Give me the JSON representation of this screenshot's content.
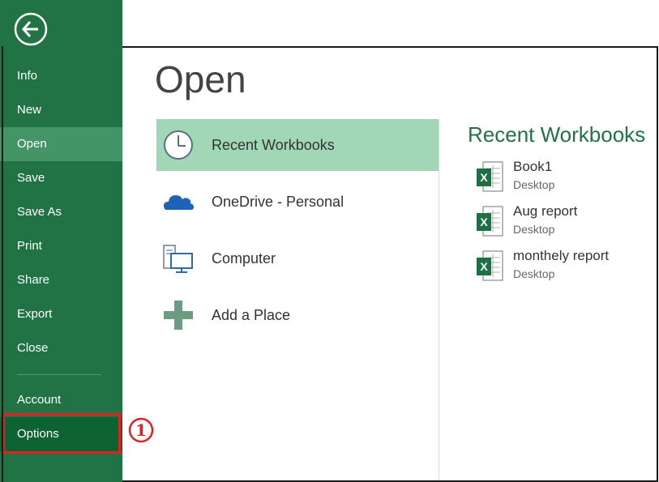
{
  "sidebar": {
    "back_icon": "back-arrow-icon",
    "items": [
      {
        "label": "Info"
      },
      {
        "label": "New"
      },
      {
        "label": "Open"
      },
      {
        "label": "Save"
      },
      {
        "label": "Save As"
      },
      {
        "label": "Print"
      },
      {
        "label": "Share"
      },
      {
        "label": "Export"
      },
      {
        "label": "Close"
      }
    ],
    "account_label": "Account",
    "options_label": "Options",
    "active_item": "Open"
  },
  "annotation": {
    "step_number": "1",
    "color": "#e51f26"
  },
  "main": {
    "title": "Open",
    "places": [
      {
        "label": "Recent Workbooks",
        "icon": "clock-icon"
      },
      {
        "label": "OneDrive - Personal",
        "icon": "cloud-icon"
      },
      {
        "label": "Computer",
        "icon": "computer-icon"
      },
      {
        "label": "Add a Place",
        "icon": "plus-icon"
      }
    ]
  },
  "recent": {
    "title": "Recent Workbooks",
    "files": [
      {
        "name": "Book1",
        "location": "Desktop",
        "icon": "excel-file-icon"
      },
      {
        "name": "Aug report",
        "location": "Desktop",
        "icon": "excel-file-icon"
      },
      {
        "name": "monthely report",
        "location": "Desktop",
        "icon": "excel-file-icon"
      }
    ]
  },
  "colors": {
    "brand": "#217346",
    "active_nav": "#439467",
    "active_place": "#a1d7b7",
    "highlight": "#e51f26"
  }
}
